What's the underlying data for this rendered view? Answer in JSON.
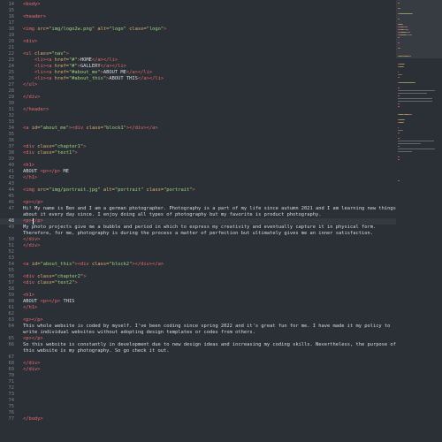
{
  "colors": {
    "background": "#2b3037",
    "line_number": "#7b828c",
    "tag": "#e86a6a",
    "attribute": "#e3b36c",
    "string": "#9bd07a",
    "text": "#d7dadf",
    "current_line": "#343a42"
  },
  "editor": {
    "current_line": 48,
    "lines": [
      {
        "n": "14",
        "t": [
          [
            "tag",
            "<body>"
          ]
        ]
      },
      {
        "n": "15",
        "t": []
      },
      {
        "n": "16",
        "t": [
          [
            "tag",
            "<header>"
          ]
        ]
      },
      {
        "n": "17",
        "t": []
      },
      {
        "n": "18",
        "t": [
          [
            "tag",
            "<img "
          ],
          [
            "attr",
            "src="
          ],
          [
            "str",
            "\"img/logo2w.png\""
          ],
          [
            "attr",
            " alt="
          ],
          [
            "str",
            "\"logo\""
          ],
          [
            "attr",
            " class="
          ],
          [
            "str",
            "\"logo\""
          ],
          [
            "tag",
            ">"
          ]
        ]
      },
      {
        "n": "19",
        "t": []
      },
      {
        "n": "20",
        "t": [
          [
            "tag",
            "<div>"
          ]
        ]
      },
      {
        "n": "21",
        "t": []
      },
      {
        "n": "22",
        "t": [
          [
            "tag",
            "<ul "
          ],
          [
            "attr",
            "class="
          ],
          [
            "str",
            "\"nav\""
          ],
          [
            "tag",
            ">"
          ]
        ]
      },
      {
        "n": "23",
        "t": [
          [
            "plain",
            "    "
          ],
          [
            "tag",
            "<li><a "
          ],
          [
            "attr",
            "href="
          ],
          [
            "str",
            "\"#\""
          ],
          [
            "tag",
            ">"
          ],
          [
            "plain",
            "HOME"
          ],
          [
            "tag",
            "</a></li>"
          ]
        ]
      },
      {
        "n": "24",
        "t": [
          [
            "plain",
            "    "
          ],
          [
            "tag",
            "<li><a "
          ],
          [
            "attr",
            "href="
          ],
          [
            "str",
            "\"#\""
          ],
          [
            "tag",
            ">"
          ],
          [
            "plain",
            "GALLERY"
          ],
          [
            "tag",
            "</a></li>"
          ]
        ]
      },
      {
        "n": "25",
        "t": [
          [
            "plain",
            "    "
          ],
          [
            "tag",
            "<li><a "
          ],
          [
            "attr",
            "href="
          ],
          [
            "str",
            "\"#about_me\""
          ],
          [
            "tag",
            ">"
          ],
          [
            "plain",
            "ABOUT ME"
          ],
          [
            "tag",
            "</a></li>"
          ]
        ]
      },
      {
        "n": "26",
        "t": [
          [
            "plain",
            "    "
          ],
          [
            "tag",
            "<li><a "
          ],
          [
            "attr",
            "href="
          ],
          [
            "str",
            "\"#about_this\""
          ],
          [
            "tag",
            ">"
          ],
          [
            "plain",
            "ABOUT THIS"
          ],
          [
            "tag",
            "</a></li>"
          ]
        ]
      },
      {
        "n": "27",
        "t": [
          [
            "tag",
            "</ul>"
          ]
        ]
      },
      {
        "n": "28",
        "t": []
      },
      {
        "n": "29",
        "t": [
          [
            "tag",
            "</div>"
          ]
        ]
      },
      {
        "n": "30",
        "t": []
      },
      {
        "n": "31",
        "t": [
          [
            "tag",
            "</header>"
          ]
        ]
      },
      {
        "n": "32",
        "t": []
      },
      {
        "n": "33",
        "t": []
      },
      {
        "n": "34",
        "t": [
          [
            "tag",
            "<a "
          ],
          [
            "attr",
            "id="
          ],
          [
            "str",
            "\"about_me\""
          ],
          [
            "tag",
            "><div "
          ],
          [
            "attr",
            "class="
          ],
          [
            "str",
            "\"block1\""
          ],
          [
            "tag",
            "></div></a>"
          ]
        ]
      },
      {
        "n": "35",
        "t": []
      },
      {
        "n": "36",
        "t": []
      },
      {
        "n": "37",
        "t": [
          [
            "tag",
            "<div "
          ],
          [
            "attr",
            "class="
          ],
          [
            "str",
            "\"chapter1\""
          ],
          [
            "tag",
            ">"
          ]
        ]
      },
      {
        "n": "38",
        "t": [
          [
            "tag",
            "<div "
          ],
          [
            "attr",
            "class="
          ],
          [
            "str",
            "\"text1\""
          ],
          [
            "tag",
            ">"
          ]
        ]
      },
      {
        "n": "39",
        "t": []
      },
      {
        "n": "40",
        "t": [
          [
            "tag",
            "<h1>"
          ]
        ]
      },
      {
        "n": "41",
        "t": [
          [
            "plain",
            "ABOUT "
          ],
          [
            "tag",
            "<p></p>"
          ],
          [
            "plain",
            " ME"
          ]
        ]
      },
      {
        "n": "42",
        "t": [
          [
            "tag",
            "</h1>"
          ]
        ]
      },
      {
        "n": "43",
        "t": []
      },
      {
        "n": "44",
        "t": [
          [
            "tag",
            "<img "
          ],
          [
            "attr",
            "src="
          ],
          [
            "str",
            "\"img/portrait.jpg\""
          ],
          [
            "attr",
            " alt="
          ],
          [
            "str",
            "\"portrait\""
          ],
          [
            "attr",
            " class="
          ],
          [
            "str",
            "\"portrait\""
          ],
          [
            "tag",
            ">"
          ]
        ]
      },
      {
        "n": "45",
        "t": []
      },
      {
        "n": "46",
        "t": [
          [
            "tag",
            "<p></p>"
          ]
        ]
      },
      {
        "n": "47",
        "t": [
          [
            "plain",
            "Hi! My name is Ben and I am a german photographer. Photography is a part of my life since autumn 2021 and I am learning new things"
          ]
        ]
      },
      {
        "n": "",
        "t": [
          [
            "plain",
            "about it every day since. I enjoy doing all types of photography but my favorite is product photography."
          ]
        ]
      },
      {
        "n": "48",
        "t": [
          [
            "tag",
            "<p></p>"
          ]
        ]
      },
      {
        "n": "49",
        "t": [
          [
            "plain",
            "My photo projects give me a bubble and period in which to express my creativity and eventually capture it in physical form."
          ]
        ]
      },
      {
        "n": "",
        "t": [
          [
            "plain",
            "Therefore, for me, photography is during the process a matter of perfection but ultimately gives me an inner satisfaction."
          ]
        ]
      },
      {
        "n": "50",
        "t": [
          [
            "tag",
            "</div>"
          ]
        ]
      },
      {
        "n": "51",
        "t": [
          [
            "tag",
            "</div>"
          ]
        ]
      },
      {
        "n": "52",
        "t": []
      },
      {
        "n": "53",
        "t": []
      },
      {
        "n": "54",
        "t": [
          [
            "tag",
            "<a "
          ],
          [
            "attr",
            "id="
          ],
          [
            "str",
            "\"about_this\""
          ],
          [
            "tag",
            "><div "
          ],
          [
            "attr",
            "class="
          ],
          [
            "str",
            "\"block2\""
          ],
          [
            "tag",
            "></div></a>"
          ]
        ]
      },
      {
        "n": "55",
        "t": []
      },
      {
        "n": "56",
        "t": [
          [
            "tag",
            "<div "
          ],
          [
            "attr",
            "class="
          ],
          [
            "str",
            "\"chapter2\""
          ],
          [
            "tag",
            ">"
          ]
        ]
      },
      {
        "n": "57",
        "t": [
          [
            "tag",
            "<div "
          ],
          [
            "attr",
            "class="
          ],
          [
            "str",
            "\"text2\""
          ],
          [
            "tag",
            ">"
          ]
        ]
      },
      {
        "n": "58",
        "t": []
      },
      {
        "n": "59",
        "t": [
          [
            "tag",
            "<h1>"
          ]
        ]
      },
      {
        "n": "60",
        "t": [
          [
            "plain",
            "ABOUT "
          ],
          [
            "tag",
            "<p></p>"
          ],
          [
            "plain",
            " THIS"
          ]
        ]
      },
      {
        "n": "61",
        "t": [
          [
            "tag",
            "</h1>"
          ]
        ]
      },
      {
        "n": "62",
        "t": []
      },
      {
        "n": "63",
        "t": [
          [
            "tag",
            "<p></p>"
          ]
        ]
      },
      {
        "n": "64",
        "t": [
          [
            "plain",
            "This whole website is coded by myself. I've been coding since spring 2022 and it's great fun for me. I have made it my policy to"
          ]
        ]
      },
      {
        "n": "",
        "t": [
          [
            "plain",
            "write individual websites without adopting design templates or codes from others."
          ]
        ]
      },
      {
        "n": "65",
        "t": [
          [
            "tag",
            "<p></p>"
          ]
        ]
      },
      {
        "n": "66",
        "t": [
          [
            "plain",
            "So this website is constantly in development due to new design ideas and increasing my coding skills. Nevertheless, the purpose of"
          ]
        ]
      },
      {
        "n": "",
        "t": [
          [
            "plain",
            "this website is my photography. So go check it out."
          ]
        ]
      },
      {
        "n": "67",
        "t": []
      },
      {
        "n": "68",
        "t": [
          [
            "tag",
            "</div>"
          ]
        ]
      },
      {
        "n": "69",
        "t": [
          [
            "tag",
            "</div>"
          ]
        ]
      },
      {
        "n": "70",
        "t": []
      },
      {
        "n": "71",
        "t": []
      },
      {
        "n": "72",
        "t": []
      },
      {
        "n": "73",
        "t": []
      },
      {
        "n": "74",
        "t": []
      },
      {
        "n": "75",
        "t": []
      },
      {
        "n": "76",
        "t": []
      },
      {
        "n": "77",
        "t": [
          [
            "tag",
            "</body>"
          ]
        ]
      }
    ]
  }
}
